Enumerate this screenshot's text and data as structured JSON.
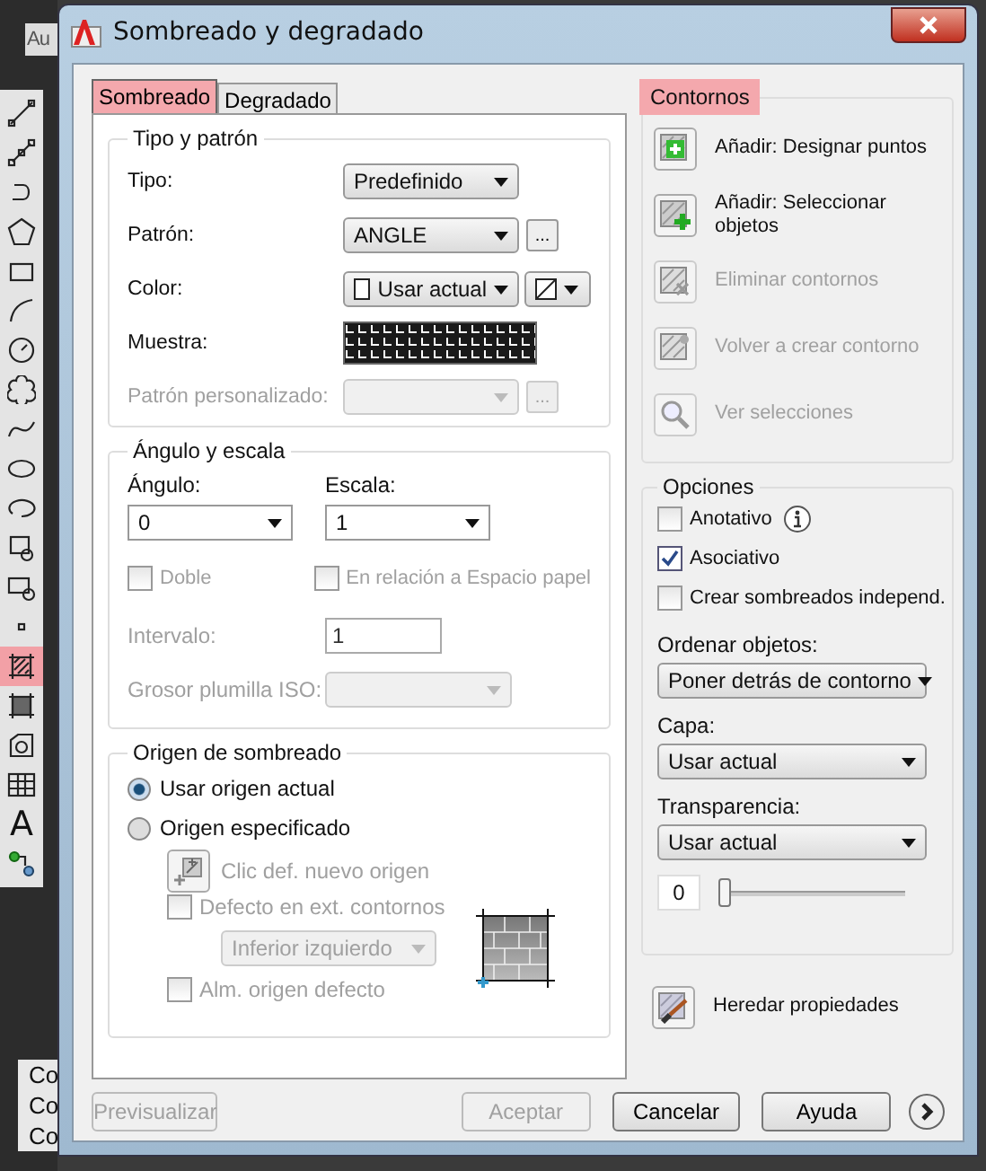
{
  "background": {
    "corner_text": "Au",
    "tools": [
      {
        "kind": "line",
        "selected": false
      },
      {
        "kind": "dimension",
        "selected": false
      },
      {
        "kind": "polyline",
        "selected": false
      },
      {
        "kind": "polygon",
        "selected": false
      },
      {
        "kind": "rectangle",
        "selected": false
      },
      {
        "kind": "arc",
        "selected": false
      },
      {
        "kind": "circle",
        "selected": false
      },
      {
        "kind": "cloud",
        "selected": false
      },
      {
        "kind": "spline",
        "selected": false
      },
      {
        "kind": "ellipse",
        "selected": false
      },
      {
        "kind": "ellipse_arc",
        "selected": false
      },
      {
        "kind": "insert",
        "selected": false
      },
      {
        "kind": "block",
        "selected": false
      },
      {
        "kind": "point",
        "selected": false
      },
      {
        "kind": "hatch",
        "selected": true
      },
      {
        "kind": "gradient",
        "selected": false
      },
      {
        "kind": "region",
        "selected": false
      },
      {
        "kind": "table",
        "selected": false
      },
      {
        "kind": "text",
        "glyph": "A",
        "selected": false
      },
      {
        "kind": "add_selected",
        "selected": false
      }
    ],
    "command_lines": [
      "Co",
      "Co",
      "Co"
    ]
  },
  "window": {
    "title": "Sombreado y degradado"
  },
  "tabs": [
    {
      "label": "Sombreado",
      "selected": true,
      "highlighted": true
    },
    {
      "label": "Degradado",
      "selected": false,
      "highlighted": false
    }
  ],
  "type_pattern": {
    "legend": "Tipo y patrón",
    "rows": [
      {
        "kind": "dropdown",
        "label": "Tipo:",
        "value": "Predefinido",
        "disabled": false
      },
      {
        "kind": "dropdown",
        "label": "Patrón:",
        "value": "ANGLE",
        "browse": "...",
        "disabled": false
      },
      {
        "kind": "color",
        "label": "Color:",
        "value": "Usar actual",
        "disabled": false
      },
      {
        "kind": "swatch",
        "label": "Muestra:",
        "disabled": false
      },
      {
        "kind": "dropdown",
        "label": "Patrón personalizado:",
        "browse": "...",
        "disabled": true
      }
    ]
  },
  "angle_scale": {
    "legend": "Ángulo y escala",
    "angle": {
      "label": "Ángulo:",
      "value": "0"
    },
    "scale": {
      "label": "Escala:",
      "value": "1"
    },
    "double": {
      "label": "Doble",
      "checked": false,
      "disabled": true
    },
    "paper": {
      "label": "En relación a Espacio papel",
      "checked": false,
      "disabled": true
    },
    "spacing": {
      "label": "Intervalo:",
      "value": "1",
      "disabled": true
    },
    "iso": {
      "label": "Grosor plumilla ISO:",
      "disabled": true
    }
  },
  "origin": {
    "legend": "Origen de sombreado",
    "options": [
      {
        "label": "Usar origen actual",
        "selected": true
      },
      {
        "label": "Origen especificado",
        "selected": false
      }
    ],
    "click": {
      "label": "Clic def. nuevo origen",
      "disabled": true
    },
    "default_ext": {
      "label": "Defecto en ext. contornos",
      "checked": false,
      "disabled": true
    },
    "position": {
      "value": "Inferior izquierdo",
      "disabled": true
    },
    "store": {
      "label": "Alm. origen defecto",
      "checked": false,
      "disabled": true
    }
  },
  "boundaries": {
    "legend": "Contornos",
    "highlighted": true,
    "actions": [
      {
        "kind": "pick_points",
        "label": "Añadir: Designar puntos",
        "disabled": false
      },
      {
        "kind": "select_objects",
        "label": "Añadir: Seleccionar objetos",
        "disabled": false
      },
      {
        "kind": "remove",
        "label": "Eliminar contornos",
        "disabled": true
      },
      {
        "kind": "recreate",
        "label": "Volver a crear contorno",
        "disabled": true
      },
      {
        "kind": "view",
        "label": "Ver selecciones",
        "disabled": true
      }
    ]
  },
  "options": {
    "legend": "Opciones",
    "checks": [
      {
        "label": "Anotativo",
        "checked": false,
        "info": true
      },
      {
        "label": "Asociativo",
        "checked": true,
        "info": false
      },
      {
        "label": "Crear sombreados independ.",
        "checked": false,
        "info": false
      }
    ],
    "selects": [
      {
        "label": "Ordenar objetos:",
        "value": "Poner detrás de contorno"
      },
      {
        "label": "Capa:",
        "value": "Usar actual"
      },
      {
        "label": "Transparencia:",
        "value": "Usar actual"
      }
    ],
    "transparency": {
      "value": "0",
      "level": 0
    }
  },
  "inherit": {
    "label": "Heredar propiedades"
  },
  "buttons": [
    {
      "label": "Previsualizar",
      "disabled": true
    },
    {
      "label": "Aceptar",
      "disabled": true
    },
    {
      "label": "Cancelar",
      "disabled": false
    },
    {
      "label": "Ayuda",
      "disabled": false
    }
  ]
}
